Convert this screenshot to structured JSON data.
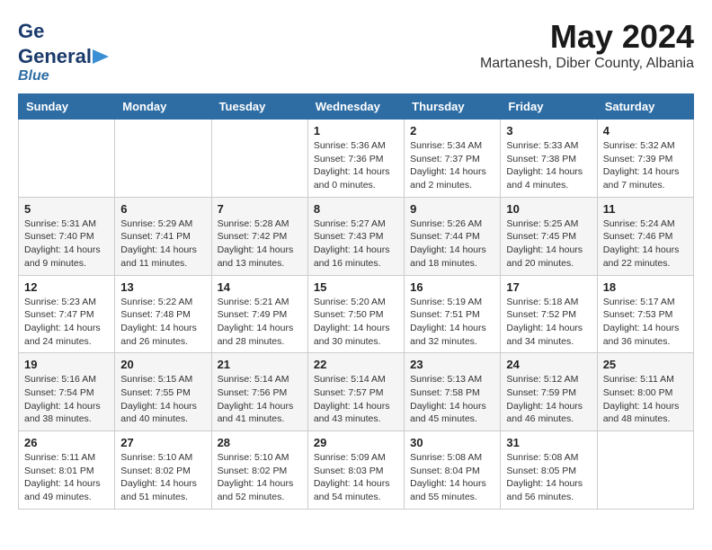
{
  "header": {
    "logo_general": "General",
    "logo_blue": "Blue",
    "month_title": "May 2024",
    "location": "Martanesh, Diber County, Albania"
  },
  "days_of_week": [
    "Sunday",
    "Monday",
    "Tuesday",
    "Wednesday",
    "Thursday",
    "Friday",
    "Saturday"
  ],
  "weeks": [
    [
      {
        "day": "",
        "info": ""
      },
      {
        "day": "",
        "info": ""
      },
      {
        "day": "",
        "info": ""
      },
      {
        "day": "1",
        "info": "Sunrise: 5:36 AM\nSunset: 7:36 PM\nDaylight: 14 hours\nand 0 minutes."
      },
      {
        "day": "2",
        "info": "Sunrise: 5:34 AM\nSunset: 7:37 PM\nDaylight: 14 hours\nand 2 minutes."
      },
      {
        "day": "3",
        "info": "Sunrise: 5:33 AM\nSunset: 7:38 PM\nDaylight: 14 hours\nand 4 minutes."
      },
      {
        "day": "4",
        "info": "Sunrise: 5:32 AM\nSunset: 7:39 PM\nDaylight: 14 hours\nand 7 minutes."
      }
    ],
    [
      {
        "day": "5",
        "info": "Sunrise: 5:31 AM\nSunset: 7:40 PM\nDaylight: 14 hours\nand 9 minutes."
      },
      {
        "day": "6",
        "info": "Sunrise: 5:29 AM\nSunset: 7:41 PM\nDaylight: 14 hours\nand 11 minutes."
      },
      {
        "day": "7",
        "info": "Sunrise: 5:28 AM\nSunset: 7:42 PM\nDaylight: 14 hours\nand 13 minutes."
      },
      {
        "day": "8",
        "info": "Sunrise: 5:27 AM\nSunset: 7:43 PM\nDaylight: 14 hours\nand 16 minutes."
      },
      {
        "day": "9",
        "info": "Sunrise: 5:26 AM\nSunset: 7:44 PM\nDaylight: 14 hours\nand 18 minutes."
      },
      {
        "day": "10",
        "info": "Sunrise: 5:25 AM\nSunset: 7:45 PM\nDaylight: 14 hours\nand 20 minutes."
      },
      {
        "day": "11",
        "info": "Sunrise: 5:24 AM\nSunset: 7:46 PM\nDaylight: 14 hours\nand 22 minutes."
      }
    ],
    [
      {
        "day": "12",
        "info": "Sunrise: 5:23 AM\nSunset: 7:47 PM\nDaylight: 14 hours\nand 24 minutes."
      },
      {
        "day": "13",
        "info": "Sunrise: 5:22 AM\nSunset: 7:48 PM\nDaylight: 14 hours\nand 26 minutes."
      },
      {
        "day": "14",
        "info": "Sunrise: 5:21 AM\nSunset: 7:49 PM\nDaylight: 14 hours\nand 28 minutes."
      },
      {
        "day": "15",
        "info": "Sunrise: 5:20 AM\nSunset: 7:50 PM\nDaylight: 14 hours\nand 30 minutes."
      },
      {
        "day": "16",
        "info": "Sunrise: 5:19 AM\nSunset: 7:51 PM\nDaylight: 14 hours\nand 32 minutes."
      },
      {
        "day": "17",
        "info": "Sunrise: 5:18 AM\nSunset: 7:52 PM\nDaylight: 14 hours\nand 34 minutes."
      },
      {
        "day": "18",
        "info": "Sunrise: 5:17 AM\nSunset: 7:53 PM\nDaylight: 14 hours\nand 36 minutes."
      }
    ],
    [
      {
        "day": "19",
        "info": "Sunrise: 5:16 AM\nSunset: 7:54 PM\nDaylight: 14 hours\nand 38 minutes."
      },
      {
        "day": "20",
        "info": "Sunrise: 5:15 AM\nSunset: 7:55 PM\nDaylight: 14 hours\nand 40 minutes."
      },
      {
        "day": "21",
        "info": "Sunrise: 5:14 AM\nSunset: 7:56 PM\nDaylight: 14 hours\nand 41 minutes."
      },
      {
        "day": "22",
        "info": "Sunrise: 5:14 AM\nSunset: 7:57 PM\nDaylight: 14 hours\nand 43 minutes."
      },
      {
        "day": "23",
        "info": "Sunrise: 5:13 AM\nSunset: 7:58 PM\nDaylight: 14 hours\nand 45 minutes."
      },
      {
        "day": "24",
        "info": "Sunrise: 5:12 AM\nSunset: 7:59 PM\nDaylight: 14 hours\nand 46 minutes."
      },
      {
        "day": "25",
        "info": "Sunrise: 5:11 AM\nSunset: 8:00 PM\nDaylight: 14 hours\nand 48 minutes."
      }
    ],
    [
      {
        "day": "26",
        "info": "Sunrise: 5:11 AM\nSunset: 8:01 PM\nDaylight: 14 hours\nand 49 minutes."
      },
      {
        "day": "27",
        "info": "Sunrise: 5:10 AM\nSunset: 8:02 PM\nDaylight: 14 hours\nand 51 minutes."
      },
      {
        "day": "28",
        "info": "Sunrise: 5:10 AM\nSunset: 8:02 PM\nDaylight: 14 hours\nand 52 minutes."
      },
      {
        "day": "29",
        "info": "Sunrise: 5:09 AM\nSunset: 8:03 PM\nDaylight: 14 hours\nand 54 minutes."
      },
      {
        "day": "30",
        "info": "Sunrise: 5:08 AM\nSunset: 8:04 PM\nDaylight: 14 hours\nand 55 minutes."
      },
      {
        "day": "31",
        "info": "Sunrise: 5:08 AM\nSunset: 8:05 PM\nDaylight: 14 hours\nand 56 minutes."
      },
      {
        "day": "",
        "info": ""
      }
    ]
  ]
}
